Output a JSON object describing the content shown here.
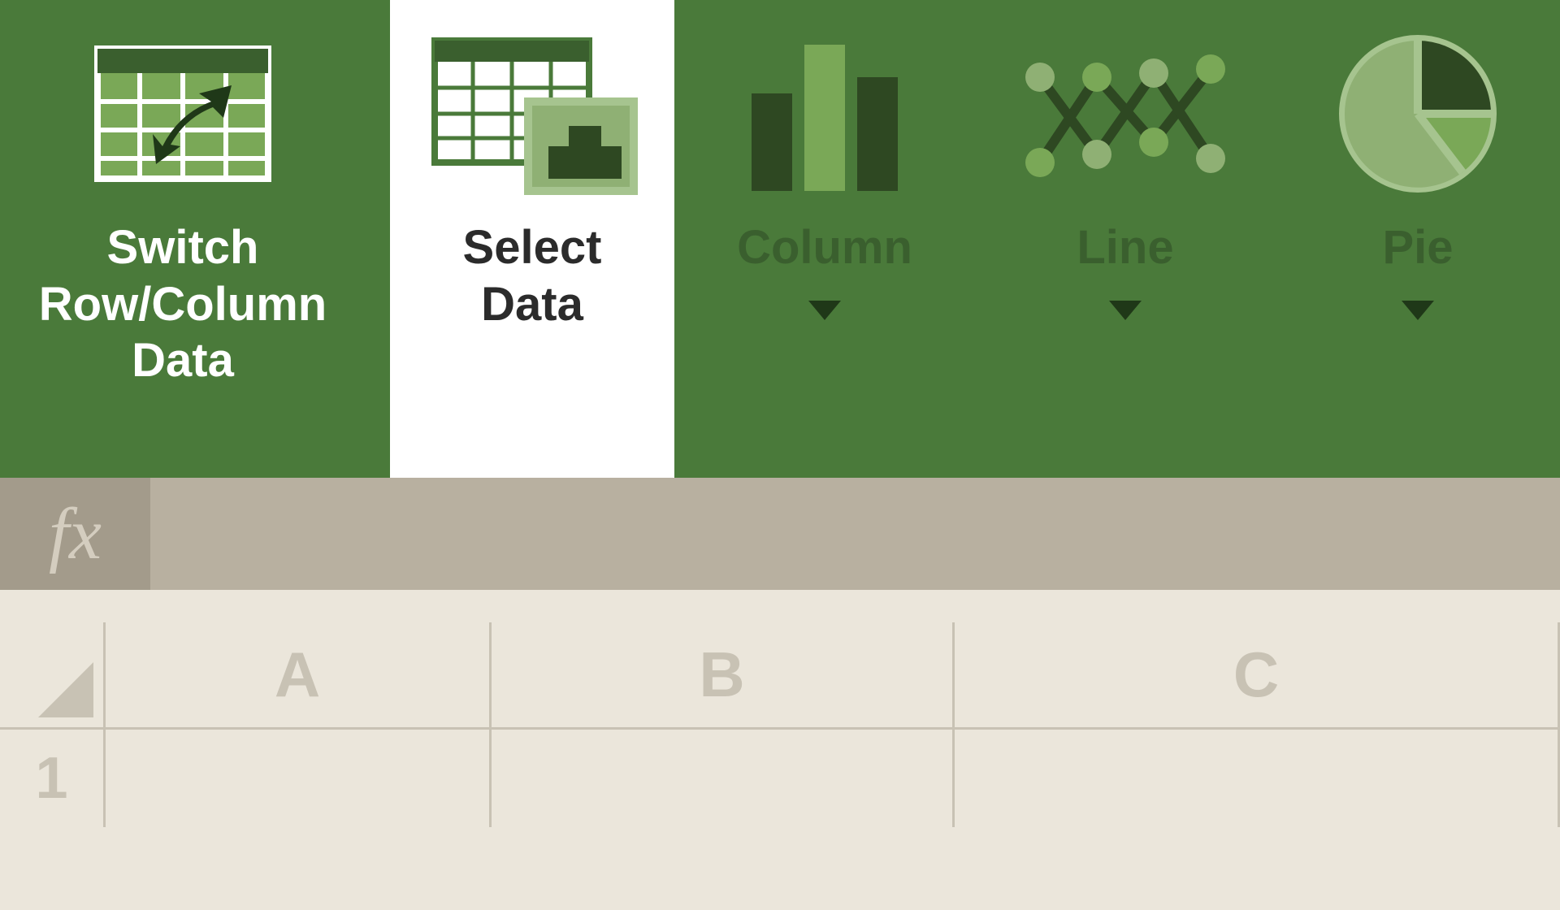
{
  "ribbon": {
    "switch": {
      "label": "Switch\nRow/Column\nData"
    },
    "select": {
      "label": "Select\nData"
    },
    "column": {
      "label": "Column"
    },
    "line": {
      "label": "Line"
    },
    "pie": {
      "label": "Pie"
    }
  },
  "formula_bar": {
    "fx": "fx",
    "value": ""
  },
  "sheet": {
    "columns": [
      "A",
      "B",
      "C"
    ],
    "rows": [
      "1"
    ]
  }
}
